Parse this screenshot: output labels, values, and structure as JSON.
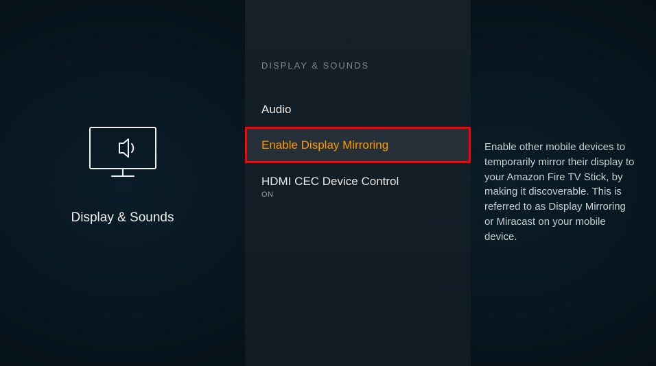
{
  "left": {
    "category_label": "Display & Sounds"
  },
  "middle": {
    "section_header": "DISPLAY & SOUNDS",
    "items": {
      "audio": {
        "label": "Audio"
      },
      "mirroring": {
        "label": "Enable Display Mirroring"
      },
      "hdmicec": {
        "label": "HDMI CEC Device Control",
        "sub": "ON"
      }
    }
  },
  "right": {
    "description": "Enable other mobile devices to temporarily mirror their display to your Amazon Fire TV Stick, by making it discoverable. This is referred to as Display Mirroring or Miracast on your mobile device."
  }
}
